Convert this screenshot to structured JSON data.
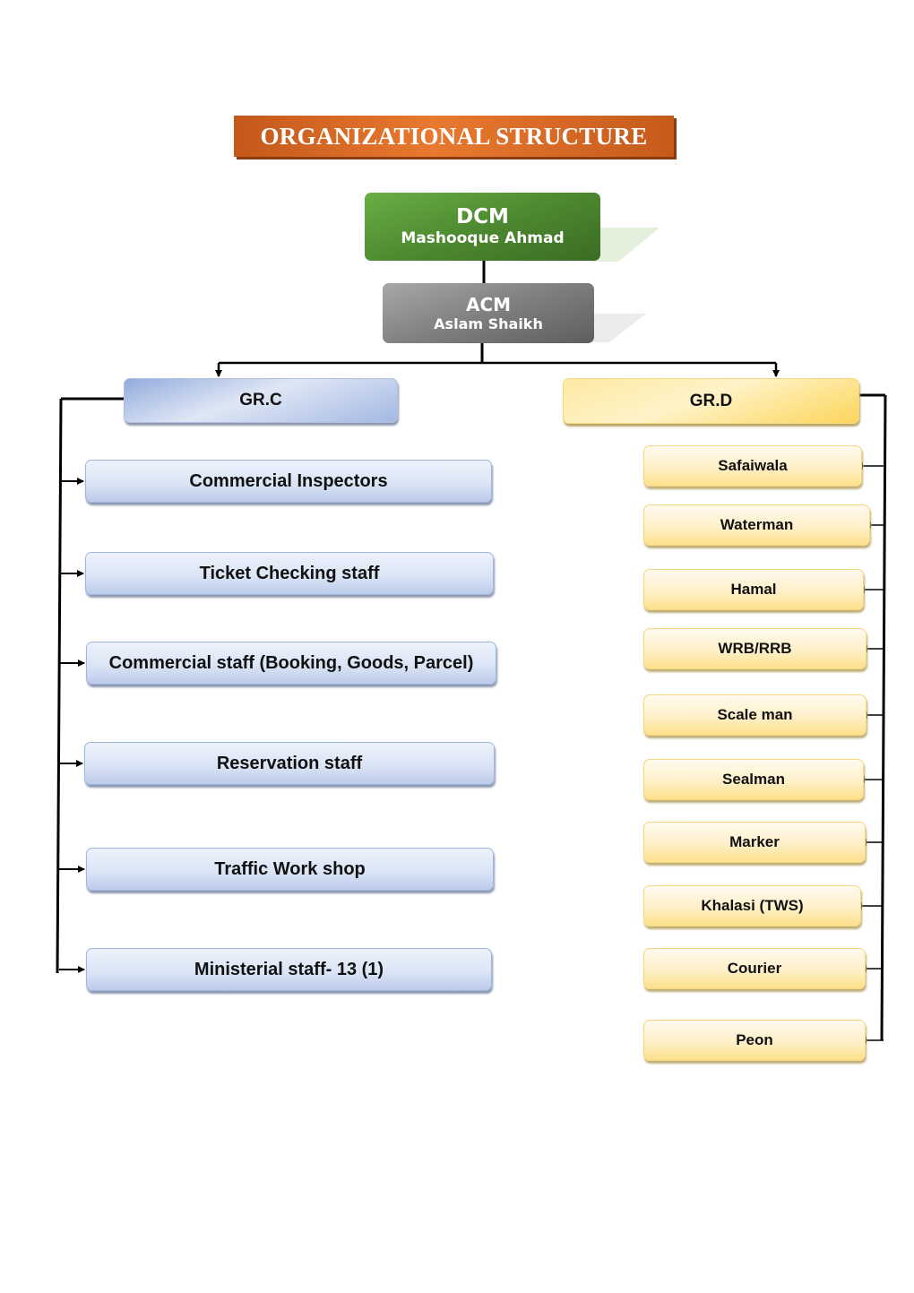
{
  "title": "ORGANIZATIONAL STRUCTURE",
  "colors": {
    "title_bg": "#d3631f",
    "dcm": "#4d8a30",
    "acm": "#7f7f7f",
    "group_c": "#c9d6f0",
    "group_d": "#fde7a0",
    "connector": "#000000"
  },
  "top": {
    "dcm": {
      "role": "DCM",
      "name": "Mashooque Ahmad"
    },
    "acm": {
      "role": "ACM",
      "name": "Aslam Shaikh"
    }
  },
  "group_c": {
    "label": "GR.C",
    "items": [
      "Commercial Inspectors",
      "Ticket Checking staff",
      "Commercial staff (Booking, Goods, Parcel)",
      "Reservation staff",
      "Traffic Work shop",
      "Ministerial staff- 13 (1)"
    ]
  },
  "group_d": {
    "label": "GR.D",
    "items": [
      "Safaiwala",
      "Waterman",
      "Hamal",
      "WRB/RRB",
      "Scale man",
      "Sealman",
      "Marker",
      "Khalasi (TWS)",
      "Courier",
      "Peon"
    ]
  }
}
